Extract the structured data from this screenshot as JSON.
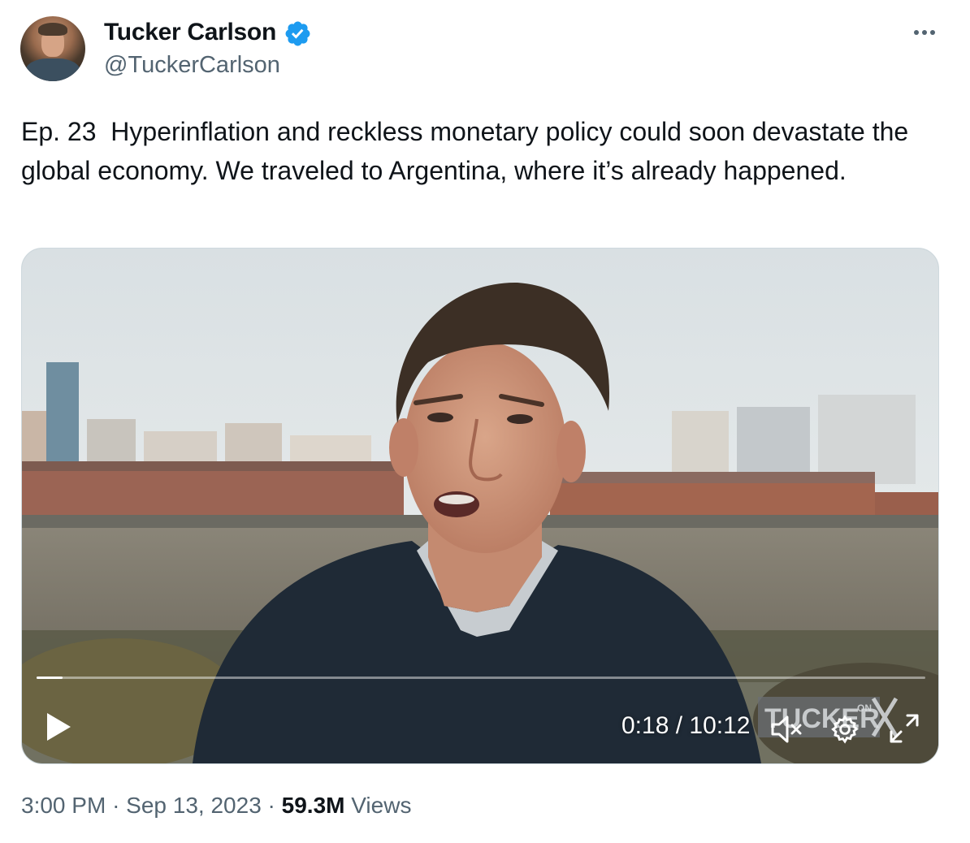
{
  "tweet": {
    "author_name": "Tucker Carlson",
    "handle": "@TuckerCarlson",
    "verified": true,
    "text": "Ep. 23  Hyperinflation and reckless monetary policy could soon devastate the global economy. We traveled to Argentina, where it’s already happened.",
    "time": "3:00 PM",
    "date": "Sep 13, 2023",
    "views_count": "59.3M",
    "views_label": "Views",
    "separator": "·"
  },
  "video": {
    "current_time": "0:18",
    "duration": "10:12",
    "time_display": "0:18 / 10:12",
    "progress": 0.029,
    "watermark_text": "TUCKER ON X",
    "muted": true
  },
  "icons": {
    "verified": "verified-badge-icon",
    "more": "more-options-icon",
    "play": "play-icon",
    "mute": "muted-speaker-icon",
    "settings": "gear-icon",
    "fullscreen": "fullscreen-icon"
  },
  "colors": {
    "verified_blue": "#1d9bf0",
    "text_primary": "#0f1419",
    "text_secondary": "#536471"
  }
}
